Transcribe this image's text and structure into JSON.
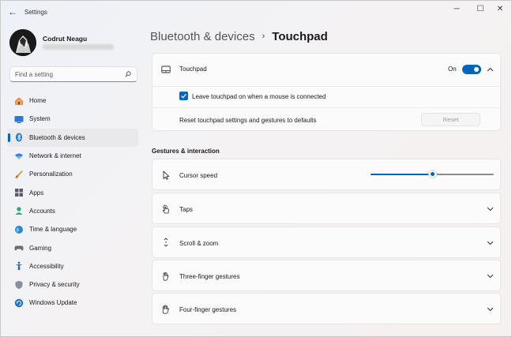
{
  "window": {
    "title": "Settings",
    "back_glyph": "←",
    "minimize_glyph": "─",
    "maximize_glyph": "☐",
    "close_glyph": "✕"
  },
  "user": {
    "name": "Codrut Neagu"
  },
  "search": {
    "placeholder": "Find a setting"
  },
  "sidebar": {
    "items": [
      {
        "label": "Home",
        "icon": "home-icon"
      },
      {
        "label": "System",
        "icon": "system-icon"
      },
      {
        "label": "Bluetooth & devices",
        "icon": "bluetooth-icon",
        "active": true
      },
      {
        "label": "Network & internet",
        "icon": "wifi-icon"
      },
      {
        "label": "Personalization",
        "icon": "brush-icon"
      },
      {
        "label": "Apps",
        "icon": "apps-icon"
      },
      {
        "label": "Accounts",
        "icon": "accounts-icon"
      },
      {
        "label": "Time & language",
        "icon": "globe-icon"
      },
      {
        "label": "Gaming",
        "icon": "gamepad-icon"
      },
      {
        "label": "Accessibility",
        "icon": "accessibility-icon"
      },
      {
        "label": "Privacy & security",
        "icon": "shield-icon"
      },
      {
        "label": "Windows Update",
        "icon": "update-icon"
      }
    ]
  },
  "breadcrumb": {
    "parent": "Bluetooth & devices",
    "separator": "›",
    "current": "Touchpad"
  },
  "touchpad": {
    "label": "Touchpad",
    "toggle_state": "On",
    "leave_on_label": "Leave touchpad on when a mouse is connected",
    "leave_on_checked": true,
    "reset_label": "Reset touchpad settings and gestures to defaults",
    "reset_button": "Reset"
  },
  "gestures": {
    "heading": "Gestures & interaction",
    "cursor_speed_label": "Cursor speed",
    "cursor_speed_value": 0.5,
    "rows": [
      {
        "label": "Taps",
        "icon": "tap-icon"
      },
      {
        "label": "Scroll & zoom",
        "icon": "scroll-icon"
      },
      {
        "label": "Three-finger gestures",
        "icon": "three-finger-icon"
      },
      {
        "label": "Four-finger gestures",
        "icon": "four-finger-icon"
      }
    ]
  },
  "colors": {
    "accent": "#0067c0"
  }
}
